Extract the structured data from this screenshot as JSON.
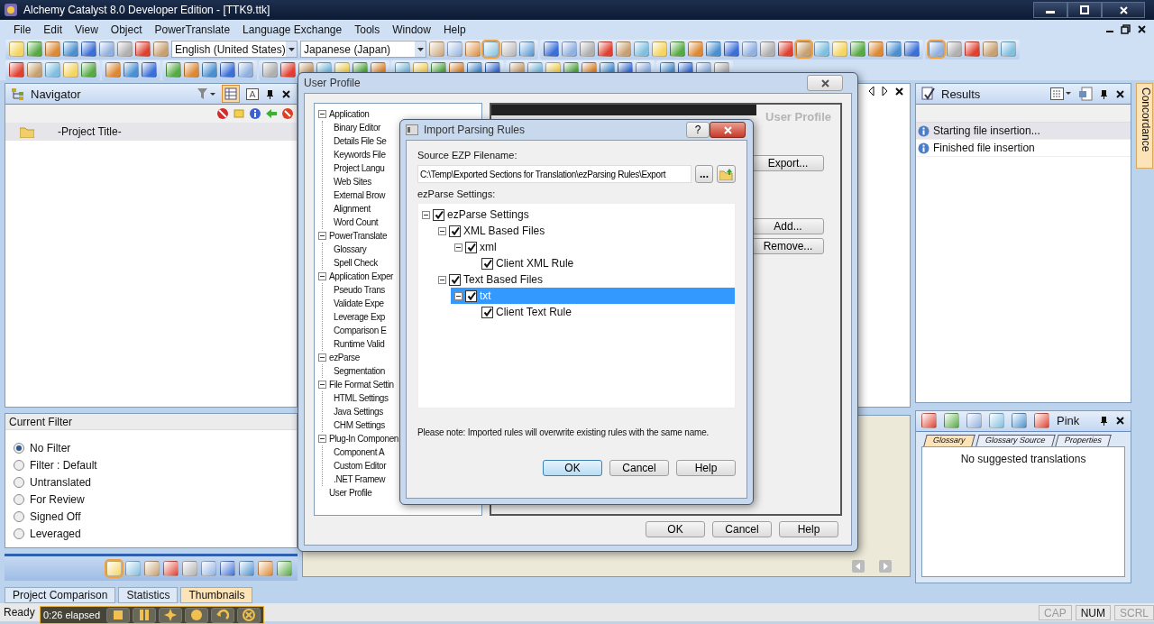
{
  "window": {
    "title": "Alchemy Catalyst 8.0 Developer Edition - [TTK9.ttk]"
  },
  "menu": [
    "File",
    "Edit",
    "View",
    "Object",
    "PowerTranslate",
    "Language Exchange",
    "Tools",
    "Window",
    "Help"
  ],
  "toolbar": {
    "source_language": "English (United States)",
    "target_language": "Japanese (Japan)"
  },
  "navigator": {
    "title": "Navigator",
    "project": "-Project Title-",
    "filter_title": "Current Filter",
    "filters": [
      {
        "label": "No Filter",
        "selected": true
      },
      {
        "label": "Filter : Default",
        "selected": false
      },
      {
        "label": "Untranslated",
        "selected": false
      },
      {
        "label": "For Review",
        "selected": false
      },
      {
        "label": "Signed Off",
        "selected": false
      },
      {
        "label": "Leveraged",
        "selected": false
      }
    ]
  },
  "bottom_tabs": [
    {
      "label": "Project Comparison",
      "selected": false
    },
    {
      "label": "Statistics",
      "selected": false
    },
    {
      "label": "Thumbnails",
      "selected": true
    }
  ],
  "recorder": {
    "elapsed": "0:26 elapsed"
  },
  "results": {
    "title": "Results",
    "items": [
      {
        "text": "Starting file insertion...",
        "selected": true
      },
      {
        "text": "Finished file insertion",
        "selected": false
      }
    ]
  },
  "side_tab": "Concordance",
  "suggestions": {
    "title": "Pink",
    "tabs": [
      {
        "label": "Glossary",
        "selected": true
      },
      {
        "label": "Glossary Source",
        "selected": false
      },
      {
        "label": "Properties",
        "selected": false
      }
    ],
    "message": "No suggested translations"
  },
  "user_profile": {
    "title": "User Profile",
    "heading": "User Profile",
    "tree": [
      {
        "label": "Application",
        "expanded": true,
        "children": [
          {
            "label": "Binary Editor"
          },
          {
            "label": "Details File Se"
          },
          {
            "label": "Keywords File"
          },
          {
            "label": "Project Langu"
          },
          {
            "label": "Web Sites"
          },
          {
            "label": "External Brow"
          },
          {
            "label": "Alignment"
          },
          {
            "label": "Word Count"
          }
        ]
      },
      {
        "label": "PowerTranslate",
        "expanded": true,
        "children": [
          {
            "label": "Glossary"
          },
          {
            "label": "Spell Check"
          }
        ]
      },
      {
        "label": "Application Exper",
        "expanded": true,
        "children": [
          {
            "label": "Pseudo Trans"
          },
          {
            "label": "Validate Expe"
          },
          {
            "label": "Leverage Exp"
          },
          {
            "label": "Comparison E"
          },
          {
            "label": "Runtime Valid"
          }
        ]
      },
      {
        "label": "ezParse",
        "expanded": true,
        "children": [
          {
            "label": "Segmentation"
          }
        ]
      },
      {
        "label": "File Format Settin",
        "expanded": true,
        "children": [
          {
            "label": "HTML Settings"
          },
          {
            "label": "Java Settings"
          },
          {
            "label": "CHM Settings"
          }
        ]
      },
      {
        "label": "Plug-In Componen",
        "expanded": true,
        "children": [
          {
            "label": "Component A"
          },
          {
            "label": "Custom Editor"
          },
          {
            "label": ".NET Framew"
          }
        ]
      },
      {
        "label": "User Profile"
      }
    ],
    "export_button": "Export...",
    "add_button": "Add...",
    "remove_button": "Remove...",
    "footer_buttons": [
      "OK",
      "Cancel",
      "Help"
    ]
  },
  "import_dialog": {
    "title": "Import Parsing Rules",
    "help_button": "?",
    "filename_label": "Source EZP Filename:",
    "filename": "C:\\Temp\\Exported Sections for Translation\\ezParsing Rules\\Export",
    "browse_button": "...",
    "settings_label": "ezParse Settings:",
    "tree": [
      {
        "label": "ezParse Settings",
        "checked": true,
        "selected": false,
        "children": [
          {
            "label": "XML Based Files",
            "checked": true,
            "selected": false,
            "children": [
              {
                "label": "xml",
                "checked": true,
                "selected": false,
                "children": [
                  {
                    "label": "Client XML Rule",
                    "checked": true,
                    "selected": false
                  }
                ]
              }
            ]
          },
          {
            "label": "Text Based Files",
            "checked": true,
            "selected": false,
            "children": [
              {
                "label": "txt",
                "checked": true,
                "selected": true,
                "children": [
                  {
                    "label": "Client Text Rule",
                    "checked": true,
                    "selected": false
                  }
                ]
              }
            ]
          }
        ]
      }
    ],
    "note": "Please note:  Imported rules will overwrite existing rules with the same name.",
    "buttons": [
      {
        "label": "OK",
        "default": true
      },
      {
        "label": "Cancel",
        "default": false
      },
      {
        "label": "Help",
        "default": false
      }
    ]
  },
  "status_bar": {
    "text": "Ready",
    "indicators": [
      {
        "label": "CAP",
        "active": false
      },
      {
        "label": "NUM",
        "active": true
      },
      {
        "label": "SCRL",
        "active": false
      }
    ]
  }
}
